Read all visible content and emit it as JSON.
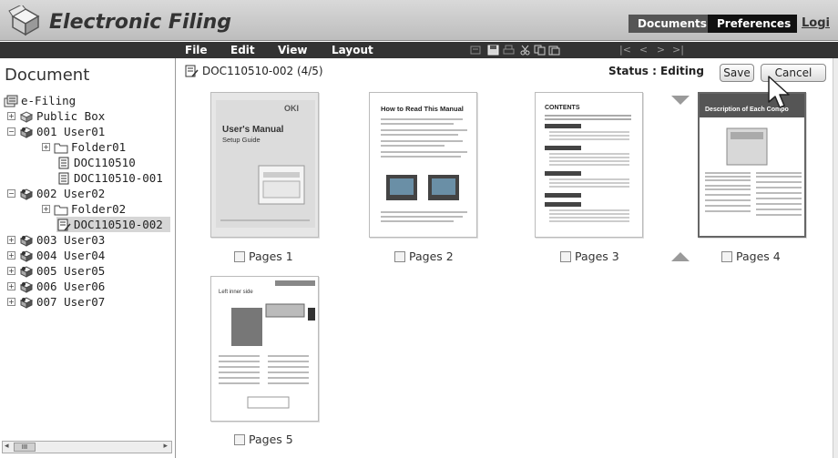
{
  "header": {
    "app_title": "Electronic Filing",
    "tabs": [
      "Documents",
      "Preferences"
    ],
    "logout_label": "Logi"
  },
  "menubar": {
    "items": [
      "File",
      "Edit",
      "View",
      "Layout"
    ],
    "toolbar_icons": [
      "edit-icon",
      "save-icon",
      "print-icon",
      "cut-icon",
      "copy-icon",
      "paste-icon",
      "first-page-icon",
      "prev-page-icon",
      "next-page-icon",
      "last-page-icon"
    ]
  },
  "sidebar": {
    "title": "Document",
    "tree": [
      {
        "label": "e-Filing",
        "icon": "efiling-icon",
        "depth": 0,
        "expander": ""
      },
      {
        "label": "Public Box",
        "icon": "box-icon",
        "depth": 1,
        "expander": "+"
      },
      {
        "label": "001 User01",
        "icon": "user-box-icon",
        "depth": 1,
        "expander": "-"
      },
      {
        "label": "Folder01",
        "icon": "folder-icon",
        "depth": 2,
        "expander": "+"
      },
      {
        "label": "DOC110510",
        "icon": "document-icon",
        "depth": 3,
        "expander": ""
      },
      {
        "label": "DOC110510-001",
        "icon": "document-icon",
        "depth": 3,
        "expander": ""
      },
      {
        "label": "002 User02",
        "icon": "user-box-icon",
        "depth": 1,
        "expander": "-"
      },
      {
        "label": "Folder02",
        "icon": "folder-icon",
        "depth": 2,
        "expander": "+"
      },
      {
        "label": "DOC110510-002",
        "icon": "document-edit-icon",
        "depth": 3,
        "expander": "",
        "selected": true
      },
      {
        "label": "003 User03",
        "icon": "user-box-icon",
        "depth": 1,
        "expander": "+"
      },
      {
        "label": "004 User04",
        "icon": "user-box-icon",
        "depth": 1,
        "expander": "+"
      },
      {
        "label": "005 User05",
        "icon": "user-box-icon",
        "depth": 1,
        "expander": "+"
      },
      {
        "label": "006 User06",
        "icon": "user-box-icon",
        "depth": 1,
        "expander": "+"
      },
      {
        "label": "007 User07",
        "icon": "user-box-icon",
        "depth": 1,
        "expander": "+"
      }
    ],
    "scroll_thumb": "III"
  },
  "main": {
    "document_name": "DOC110510-002",
    "page_indicator": "(4/5)",
    "status": "Status : Editing",
    "save_label": "Save",
    "cancel_label": "Cancel",
    "pages": [
      {
        "label": "Pages 1",
        "cover_title": "User's Manual",
        "cover_subtitle": "Setup Guide",
        "brand": "OKI"
      },
      {
        "label": "Pages 2",
        "heading": "How to Read This Manual"
      },
      {
        "label": "Pages 3",
        "heading": "CONTENTS"
      },
      {
        "label": "Pages 4",
        "heading": "Description of Each Compo"
      },
      {
        "label": "Pages 5",
        "heading": "Left inner side"
      }
    ]
  }
}
